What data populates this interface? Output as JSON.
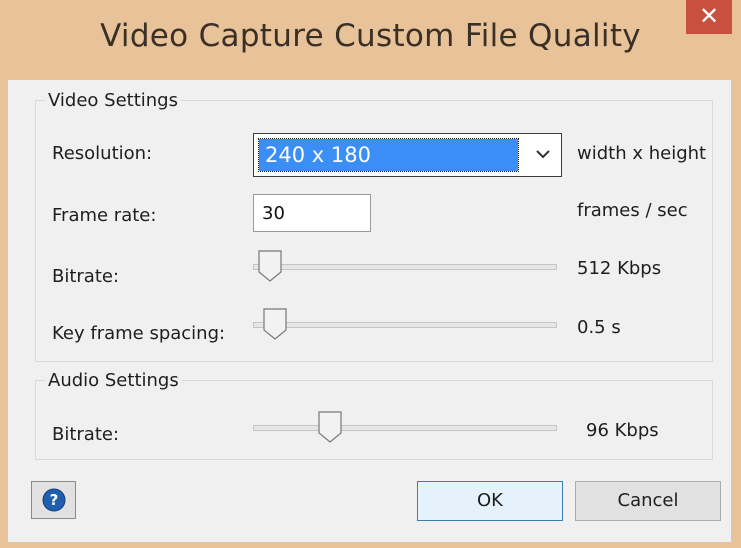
{
  "window": {
    "title": "Video Capture Custom File Quality",
    "close_glyph": "✕"
  },
  "video": {
    "legend": "Video Settings",
    "resolution_label": "Resolution:",
    "resolution_value": "240 x 180",
    "resolution_hint": "width x height",
    "framerate_label": "Frame rate:",
    "framerate_value": "30",
    "framerate_unit": "frames / sec",
    "bitrate_label": "Bitrate:",
    "bitrate_value": "512 Kbps",
    "bitrate_level": 0.05,
    "keyframe_label": "Key frame spacing:",
    "keyframe_value": "0.5 s",
    "keyframe_level": 0.05
  },
  "audio": {
    "legend": "Audio Settings",
    "bitrate_label": "Bitrate:",
    "bitrate_value": "96 Kbps",
    "bitrate_level": 0.27
  },
  "buttons": {
    "ok": "OK",
    "cancel": "Cancel",
    "help_icon": "question-circle-icon"
  },
  "colors": {
    "titlebar": "#e8c39a",
    "close": "#c7503f",
    "selection": "#3b8ef6",
    "help": "#1f5fae"
  }
}
